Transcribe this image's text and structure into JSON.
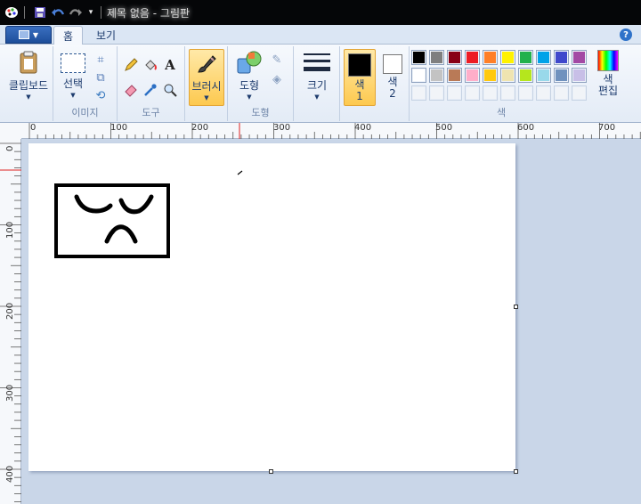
{
  "titlebar": {
    "title": "제목 없음 - 그림판"
  },
  "tabs": {
    "home": "홈",
    "view": "보기"
  },
  "groups": {
    "clipboard": {
      "button": "클립보드"
    },
    "image": {
      "label": "이미지",
      "select": "선택"
    },
    "tools": {
      "label": "도구"
    },
    "brushes": {
      "button": "브러시"
    },
    "shapes": {
      "label": "도형",
      "button": "도형"
    },
    "size": {
      "button": "크기"
    },
    "color1": {
      "label": "색\n1",
      "value": "#000000"
    },
    "color2": {
      "label": "색\n2",
      "value": "#ffffff"
    },
    "colors": {
      "label": "색",
      "edit": "색\n편집"
    }
  },
  "palette": [
    "#000000",
    "#7f7f7f",
    "#880015",
    "#ed1c24",
    "#ff7f27",
    "#fff200",
    "#22b14c",
    "#00a2e8",
    "#3f48cc",
    "#a349a4",
    "#ffffff",
    "#c3c3c3",
    "#b97a57",
    "#ffaec9",
    "#ffc90e",
    "#efe4b0",
    "#b5e61d",
    "#99d9ea",
    "#7092be",
    "#c8bfe7",
    "#ffffff",
    "#ffffff",
    "#ffffff",
    "#ffffff",
    "#ffffff",
    "#ffffff",
    "#ffffff",
    "#ffffff",
    "#ffffff",
    "#ffffff"
  ],
  "ruler": {
    "h": [
      "0",
      "100",
      "200",
      "300",
      "400",
      "500",
      "600",
      "700"
    ],
    "v": [
      "0",
      "100",
      "200",
      "300",
      "400"
    ]
  },
  "icons": {
    "app": "paint-app-icon",
    "save": "save-icon",
    "undo": "undo-icon",
    "redo": "redo-icon"
  }
}
